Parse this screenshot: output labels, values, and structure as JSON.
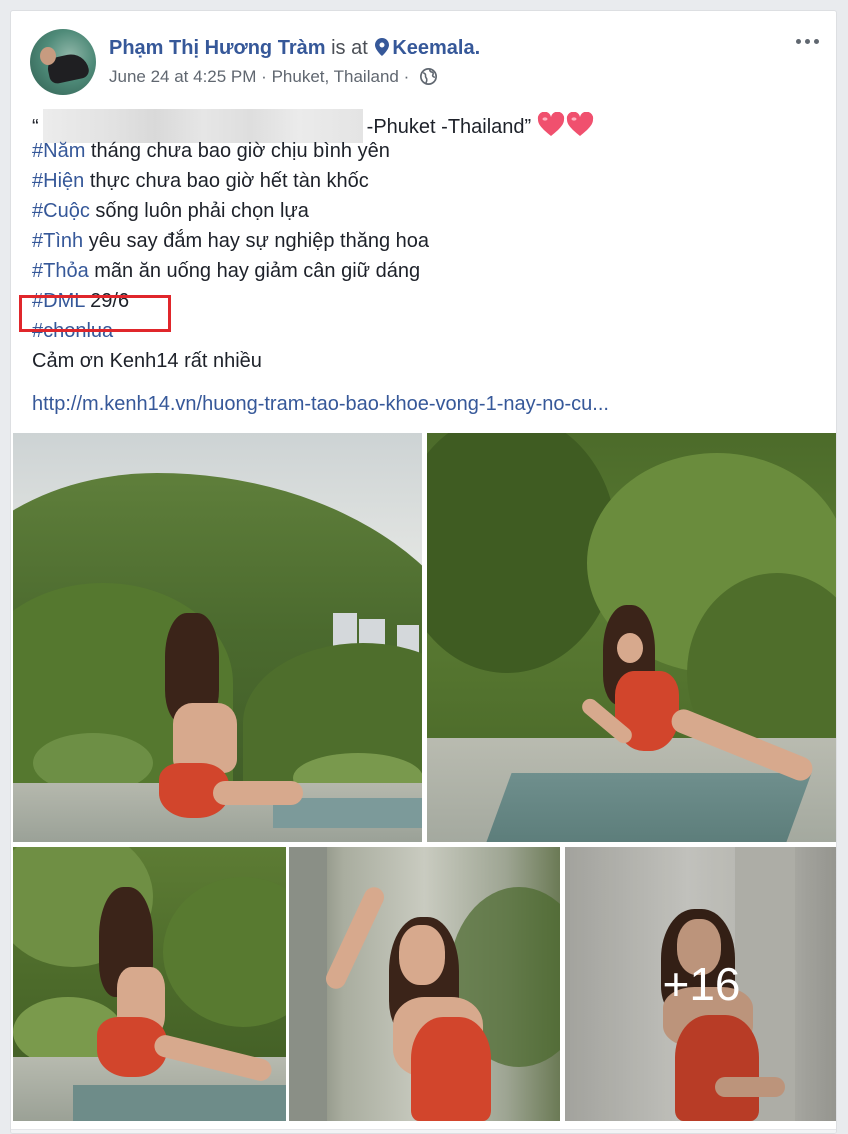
{
  "post": {
    "author": "Phạm Thị Hương Tràm",
    "is_at": "is at",
    "place": "Keemala.",
    "date": "June 24 at 4:25 PM",
    "separator": "·",
    "location": "Phuket, Thailand",
    "more_icon": "more-horizontal-icon",
    "privacy_icon": "globe-icon"
  },
  "caption": {
    "line1_open_quote": "“",
    "line1_suffix": "-Phuket -Thailand”",
    "lines": [
      {
        "tag": "#Năm",
        "text": " tháng chưa bao giờ chịu bình yên"
      },
      {
        "tag": "#Hiện",
        "text": " thực chưa bao giờ hết tàn khốc"
      },
      {
        "tag": "#Cuộc",
        "text": " sống luôn phải chọn lựa"
      },
      {
        "tag": "#Tình",
        "text": " yêu say đắm hay sự nghiệp thăng hoa"
      },
      {
        "tag": "#Thỏa",
        "text": " mãn ăn uống hay giảm cân giữ dáng"
      },
      {
        "tag": "#DML",
        "text": " 29/6"
      },
      {
        "tag": "#chonlua",
        "text": ""
      }
    ],
    "thanks": "Cảm ơn Kenh14 rất nhiều",
    "link": "http://m.kenh14.vn/huong-tram-tao-bao-khoe-vong-1-nay-no-cu..."
  },
  "photos": {
    "more_count": "+16"
  },
  "colors": {
    "link_blue": "#365899",
    "highlight_red": "#e0262b",
    "heart": "#f0506e"
  }
}
